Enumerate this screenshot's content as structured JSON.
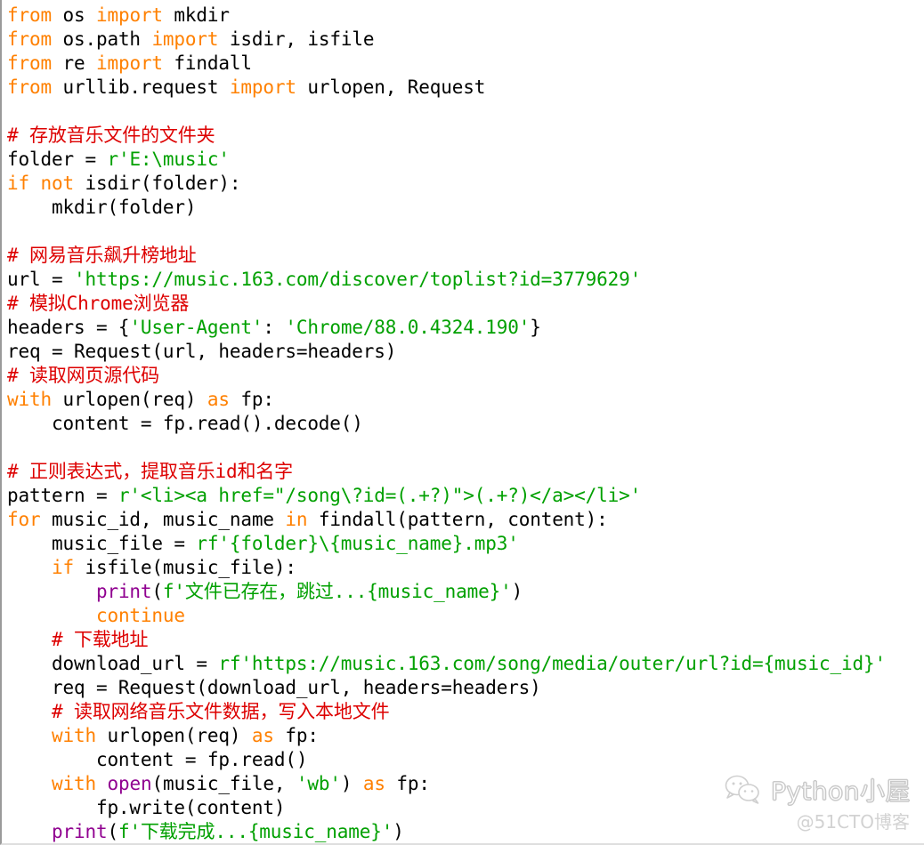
{
  "editor": {
    "language": "Python",
    "background_color": "#ffffff",
    "colors": {
      "keyword": "#ff8000",
      "string": "#00a000",
      "comment": "#dd0000",
      "builtin": "#900090",
      "text": "#000000"
    }
  },
  "code_lines": [
    {
      "id": 1,
      "text": "from os import mkdir"
    },
    {
      "id": 2,
      "text": "from os.path import isdir, isfile"
    },
    {
      "id": 3,
      "text": "from re import findall"
    },
    {
      "id": 4,
      "text": "from urllib.request import urlopen, Request"
    },
    {
      "id": 5,
      "text": ""
    },
    {
      "id": 6,
      "text": "# 存放音乐文件的文件夹"
    },
    {
      "id": 7,
      "text": "folder = r'E:\\music'"
    },
    {
      "id": 8,
      "text": "if not isdir(folder):"
    },
    {
      "id": 9,
      "text": "    mkdir(folder)"
    },
    {
      "id": 10,
      "text": ""
    },
    {
      "id": 11,
      "text": "# 网易音乐飙升榜地址"
    },
    {
      "id": 12,
      "text": "url = 'https://music.163.com/discover/toplist?id=3779629'"
    },
    {
      "id": 13,
      "text": "# 模拟Chrome浏览器"
    },
    {
      "id": 14,
      "text": "headers = {'User-Agent': 'Chrome/88.0.4324.190'}"
    },
    {
      "id": 15,
      "text": "req = Request(url, headers=headers)"
    },
    {
      "id": 16,
      "text": "# 读取网页源代码"
    },
    {
      "id": 17,
      "text": "with urlopen(req) as fp:"
    },
    {
      "id": 18,
      "text": "    content = fp.read().decode()"
    },
    {
      "id": 19,
      "text": ""
    },
    {
      "id": 20,
      "text": "# 正则表达式，提取音乐id和名字"
    },
    {
      "id": 21,
      "text": "pattern = r'<li><a href=\"/song\\?id=(.+?)\">(.+?)</a></li>'"
    },
    {
      "id": 22,
      "text": "for music_id, music_name in findall(pattern, content):"
    },
    {
      "id": 23,
      "text": "    music_file = rf'{folder}\\{music_name}.mp3'"
    },
    {
      "id": 24,
      "text": "    if isfile(music_file):"
    },
    {
      "id": 25,
      "text": "        print(f'文件已存在，跳过...{music_name}')"
    },
    {
      "id": 26,
      "text": "        continue"
    },
    {
      "id": 27,
      "text": "    # 下载地址"
    },
    {
      "id": 28,
      "text": "    download_url = rf'https://music.163.com/song/media/outer/url?id={music_id}'"
    },
    {
      "id": 29,
      "text": "    req = Request(download_url, headers=headers)"
    },
    {
      "id": 30,
      "text": "    # 读取网络音乐文件数据，写入本地文件"
    },
    {
      "id": 31,
      "text": "    with urlopen(req) as fp:"
    },
    {
      "id": 32,
      "text": "        content = fp.read()"
    },
    {
      "id": 33,
      "text": "    with open(music_file, 'wb') as fp:"
    },
    {
      "id": 34,
      "text": "        fp.write(content)"
    },
    {
      "id": 35,
      "text": "    print(f'下载完成...{music_name}')"
    }
  ],
  "watermark": {
    "icon": "wechat-icon",
    "title": "Python小屋",
    "subtitle": "@51CTO博客"
  }
}
